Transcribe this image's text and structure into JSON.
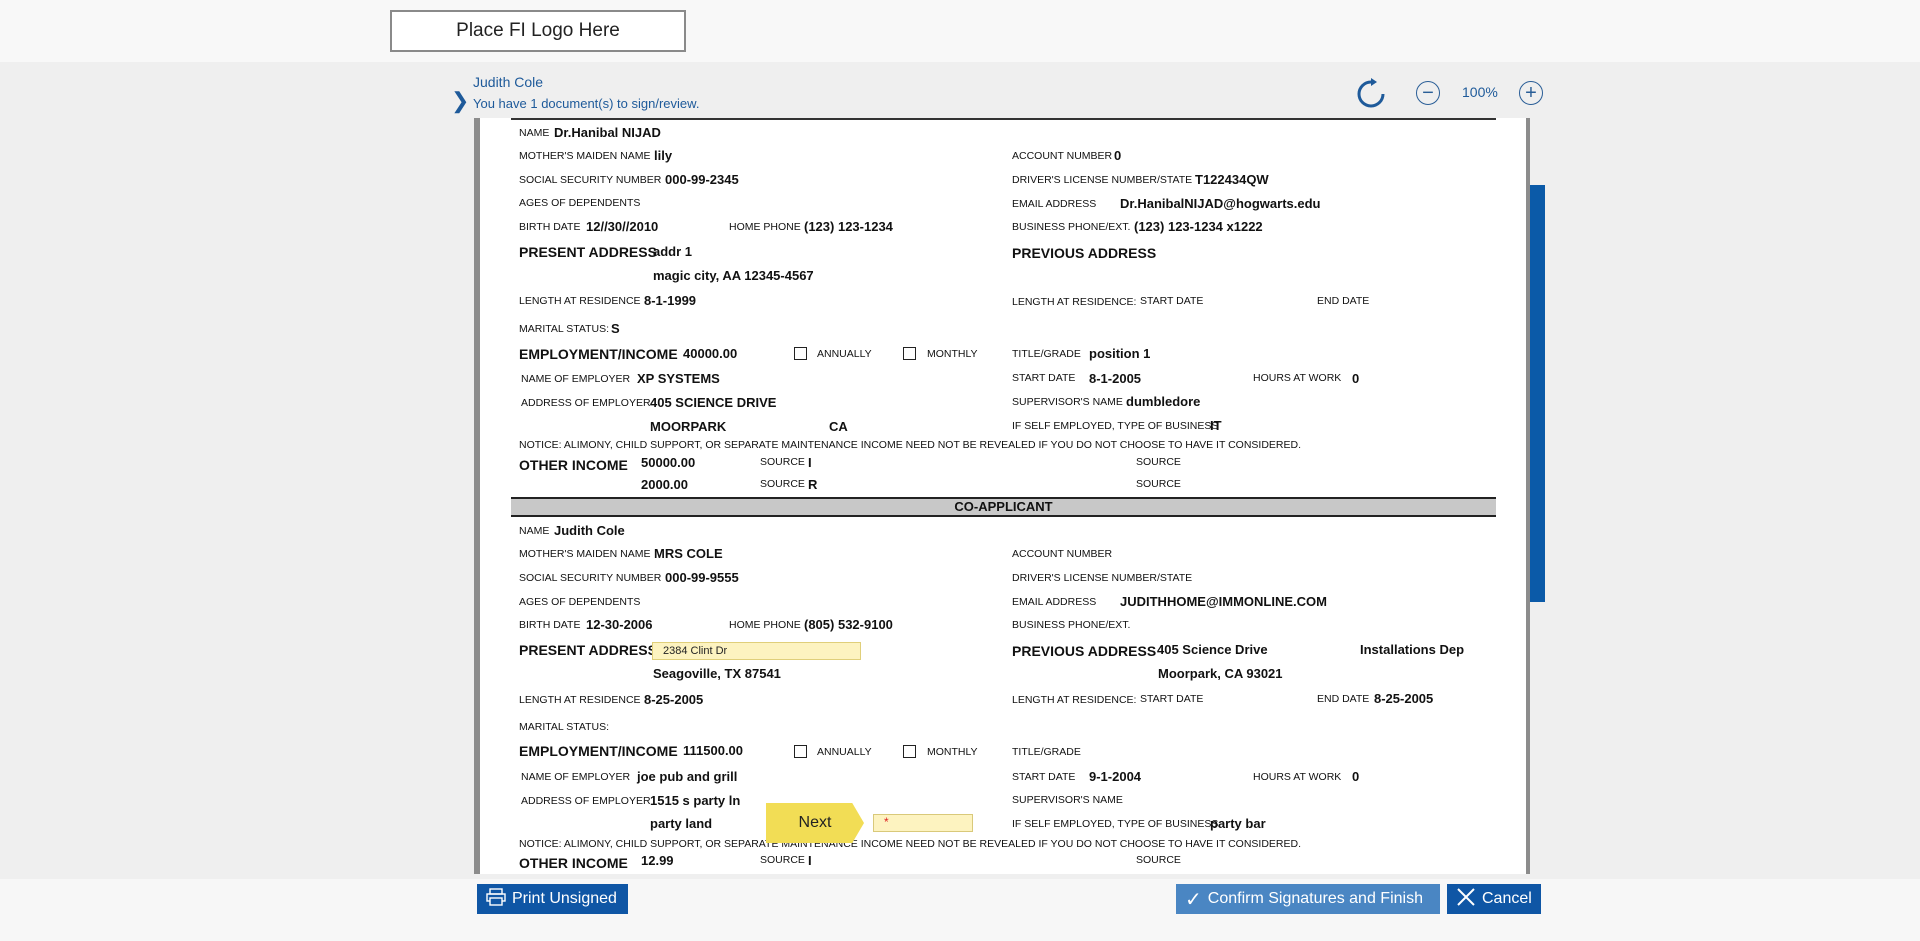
{
  "header": {
    "logo_text": "Place FI Logo Here"
  },
  "signer": {
    "name": "Judith Cole",
    "message": "You have 1 document(s) to sign/review."
  },
  "toolbar": {
    "zoom": "100%",
    "refresh_icon": "refresh-icon",
    "zoom_out_icon": "minus-circle-icon",
    "zoom_in_icon": "plus-circle-icon"
  },
  "labels": {
    "name": "NAME",
    "mothers_maiden": "MOTHER'S MAIDEN NAME",
    "ssn": "SOCIAL SECURITY NUMBER",
    "ages": "AGES OF DEPENDENTS",
    "birth": "BIRTH DATE",
    "home_phone": "HOME PHONE",
    "present_addr": "PRESENT ADDRESS",
    "length_res": "LENGTH AT RESIDENCE",
    "marital": "MARITAL STATUS:",
    "employment": "EMPLOYMENT/INCOME",
    "annually": "ANNUALLY",
    "monthly": "MONTHLY",
    "employer": "NAME OF EMPLOYER",
    "employer_addr": "ADDRESS OF EMPLOYER",
    "notice": "NOTICE: ALIMONY, CHILD SUPPORT, OR SEPARATE MAINTENANCE INCOME NEED NOT BE REVEALED IF YOU DO NOT CHOOSE TO HAVE IT CONSIDERED.",
    "other_income": "OTHER INCOME",
    "source": "SOURCE",
    "account": "ACCOUNT NUMBER",
    "dl": "DRIVER'S LICENSE NUMBER/STATE",
    "email": "EMAIL ADDRESS",
    "business_phone": "BUSINESS PHONE/EXT.",
    "prev_addr": "PREVIOUS ADDRESS",
    "length_res2": "LENGTH AT RESIDENCE:",
    "start_date": "START DATE",
    "end_date": "END DATE",
    "title_grade": "TITLE/GRADE",
    "hours": "HOURS AT WORK",
    "supervisor": "SUPERVISOR'S NAME",
    "self_employed": "IF SELF EMPLOYED, TYPE OF BUSINESS",
    "co_applicant": "CO-APPLICANT"
  },
  "applicant": {
    "name": "Dr.Hanibal NIJAD",
    "mothers_maiden": "lily",
    "ssn": "000-99-2345",
    "birth": "12//30//2010",
    "home_phone": "(123) 123-1234",
    "addr1": "addr 1",
    "addr2": "magic city, AA 12345-4567",
    "length_res": "8-1-1999",
    "marital": "S",
    "income": "40000.00",
    "employer": "XP SYSTEMS",
    "employer_addr1": "405 SCIENCE DRIVE",
    "employer_city": "MOORPARK",
    "employer_state": "CA",
    "other_income1": "50000.00",
    "source1": "I",
    "other_income2": "2000.00",
    "source2": "R",
    "account": "0",
    "dl": "T122434QW",
    "email": "Dr.HanibalNIJAD@hogwarts.edu",
    "business_phone": "(123) 123-1234 x1222",
    "title": "position 1",
    "start_date": "8-1-2005",
    "hours": "0",
    "supervisor": "dumbledore",
    "business_type": "IT"
  },
  "coapplicant": {
    "name": "Judith Cole",
    "mothers_maiden": "MRS COLE",
    "ssn": "000-99-9555",
    "birth": "12-30-2006",
    "home_phone": "(805) 532-9100",
    "addr_field": "2384 Clint Dr",
    "addr2": "Seagoville, TX 87541",
    "length_res": "8-25-2005",
    "income": "111500.00",
    "employer": "joe pub and grill",
    "employer_addr1": "1515 s party ln",
    "employer_city": "party land",
    "other_income1": "12.99",
    "source1": "I",
    "email": "JUDITHHOME@IMMONLINE.COM",
    "prev_addr1": "405 Science Drive",
    "prev_addr_extra": "Installations Dep",
    "prev_addr2": "Moorpark, CA 93021",
    "end_date": "8-25-2005",
    "start_date": "9-1-2004",
    "hours": "0",
    "business_type": "party bar"
  },
  "next_button": "Next",
  "required_marker": "*",
  "footer": {
    "print": "Print Unsigned",
    "confirm": "Confirm Signatures and Finish",
    "cancel": "Cancel"
  }
}
